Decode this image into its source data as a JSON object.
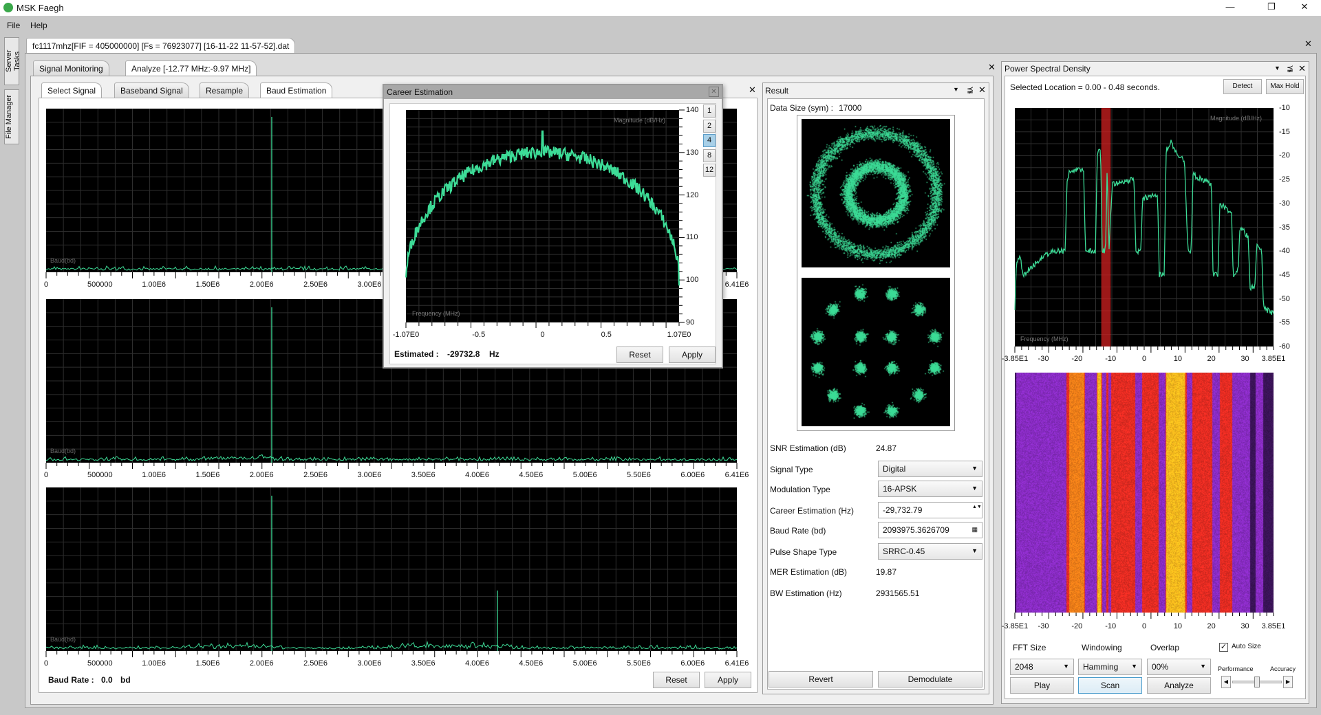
{
  "app": {
    "title": "MSK Faegh",
    "menu": [
      "File",
      "Help"
    ],
    "side_tabs": [
      "Server Tasks",
      "File Manager"
    ]
  },
  "doc_tab": "fc1117mhz[FIF = 405000000] [Fs = 76923077] [16-11-22 11-57-52].dat",
  "analysis_tabs": [
    "Signal Monitoring",
    "Analyze [-12.77 MHz:-9.97 MHz]"
  ],
  "sub_tabs": [
    "Select Signal",
    "Baseband Signal",
    "Resample",
    "Baud Estimation"
  ],
  "baud": {
    "plot_label": "Baud(bd)",
    "x_ticks": [
      "0",
      "500000",
      "1.00E6",
      "1.50E6",
      "2.00E6",
      "2.50E6",
      "3.00E6",
      "3.50E6",
      "4.00E6",
      "4.50E6",
      "5.00E6",
      "5.50E6",
      "6.00E6",
      "6.41E6"
    ],
    "x_tick_values": [
      0,
      500000,
      1000000,
      1500000,
      2000000,
      2500000,
      3000000,
      3500000,
      4000000,
      4500000,
      5000000,
      5500000,
      6000000,
      6410000
    ],
    "xlim": [
      0,
      6410000
    ],
    "peaks": [
      [
        2093975
      ],
      [
        2093975
      ],
      [
        2093975,
        4187950
      ]
    ],
    "baud_rate_label": "Baud Rate :",
    "baud_rate_value": "0.0",
    "baud_rate_unit": "bd",
    "reset": "Reset",
    "apply": "Apply"
  },
  "career": {
    "title": "Career Estimation",
    "ylabel": "Magnitude (dB/Hz)",
    "xlabel": "Frequency (MHz)",
    "x_ticks": [
      "-1.07E0",
      "-0.5",
      "0",
      "0.5",
      "1.07E0"
    ],
    "x_tick_values": [
      -1.07,
      -0.5,
      0,
      0.5,
      1.07
    ],
    "y_ticks": [
      "140",
      "130",
      "120",
      "110",
      "100",
      "90"
    ],
    "y_tick_values": [
      140,
      130,
      120,
      110,
      100,
      90
    ],
    "xlim": [
      -1.07,
      1.07
    ],
    "ylim": [
      90,
      140
    ],
    "power_buttons": [
      "1",
      "2",
      "4",
      "8",
      "12"
    ],
    "power_selected": "4",
    "estimated_label": "Estimated :",
    "estimated_value": "-29732.8",
    "estimated_unit": "Hz",
    "reset": "Reset",
    "apply": "Apply"
  },
  "result": {
    "title": "Result",
    "data_size_label": "Data Size (sym) :",
    "data_size": "17000",
    "rows": [
      {
        "label": "SNR Estimation (dB)",
        "value": "24.87",
        "kind": "text"
      },
      {
        "label": "Signal Type",
        "value": "Digital",
        "kind": "select"
      },
      {
        "label": "Modulation Type",
        "value": "16-APSK",
        "kind": "select"
      },
      {
        "label": "Career Estimation (Hz)",
        "value": "-29,732.79",
        "kind": "spin"
      },
      {
        "label": "Baud Rate (bd)",
        "value": "2093975.3626709",
        "kind": "calc"
      },
      {
        "label": "Pulse Shape Type",
        "value": "SRRC-0.45",
        "kind": "select"
      },
      {
        "label": "MER Estimation (dB)",
        "value": "19.87",
        "kind": "text"
      },
      {
        "label": "BW Estimation (Hz)",
        "value": "2931565.51",
        "kind": "text"
      }
    ],
    "revert": "Revert",
    "demodulate": "Demodulate"
  },
  "psd": {
    "title": "Power Spectral Density",
    "selected_location": "Selected Location = 0.00 - 0.48 seconds.",
    "detect": "Detect",
    "max_hold": "Max Hold",
    "ylabel": "Magnitude (dB/Hz)",
    "xlabel": "Frequency (MHz)",
    "x_ticks": [
      "-3.85E1",
      "-30",
      "-20",
      "-10",
      "0",
      "10",
      "20",
      "30",
      "3.85E1"
    ],
    "x_tick_values": [
      -38.5,
      -30,
      -20,
      -10,
      0,
      10,
      20,
      30,
      38.5
    ],
    "y_ticks": [
      "-10",
      "-15",
      "-20",
      "-25",
      "-30",
      "-35",
      "-40",
      "-45",
      "-50",
      "-55",
      "-60"
    ],
    "y_tick_values": [
      -10,
      -15,
      -20,
      -25,
      -30,
      -35,
      -40,
      -45,
      -50,
      -55,
      -60
    ],
    "xlim": [
      -38.5,
      38.5
    ],
    "ylim": [
      -60,
      -10
    ],
    "selection_mhz": [
      -12.77,
      -9.97
    ],
    "series": [
      [
        -38.5,
        -52
      ],
      [
        -38,
        -42
      ],
      [
        -37,
        -41
      ],
      [
        -36,
        -45
      ],
      [
        -33,
        -43
      ],
      [
        -30,
        -41
      ],
      [
        -27,
        -40
      ],
      [
        -23.5,
        -40
      ],
      [
        -23,
        -25
      ],
      [
        -22,
        -23
      ],
      [
        -18,
        -23
      ],
      [
        -17.5,
        -40
      ],
      [
        -14.5,
        -40
      ],
      [
        -14,
        -20
      ],
      [
        -13,
        -18
      ],
      [
        -12.5,
        -40
      ],
      [
        -11.5,
        -40
      ],
      [
        -11,
        -22
      ],
      [
        -10.5,
        -40
      ],
      [
        -9.5,
        -26
      ],
      [
        -3,
        -25
      ],
      [
        -2.5,
        -40
      ],
      [
        -1,
        -40
      ],
      [
        -0.5,
        -29
      ],
      [
        4,
        -28
      ],
      [
        4.5,
        -45
      ],
      [
        6,
        -45
      ],
      [
        6.5,
        -19
      ],
      [
        8,
        -17
      ],
      [
        10,
        -20
      ],
      [
        12,
        -21
      ],
      [
        13,
        -40
      ],
      [
        14,
        -40
      ],
      [
        14.5,
        -24
      ],
      [
        20,
        -26
      ],
      [
        20.5,
        -45
      ],
      [
        22,
        -45
      ],
      [
        22.5,
        -30
      ],
      [
        26,
        -32
      ],
      [
        26.5,
        -45
      ],
      [
        28,
        -44
      ],
      [
        28.5,
        -35
      ],
      [
        31,
        -37
      ],
      [
        31.5,
        -48
      ],
      [
        33,
        -47
      ],
      [
        33.5,
        -38
      ],
      [
        35,
        -40
      ],
      [
        35.5,
        -52
      ],
      [
        38.5,
        -53
      ]
    ],
    "trace_color": "#3ddc97",
    "selection_color": "#d02020",
    "fft_label": "FFT Size",
    "fft": "2048",
    "window_label": "Windowing",
    "window": "Hamming",
    "overlap_label": "Overlap",
    "overlap": "00%",
    "auto_size": "Auto Size",
    "auto_size_checked": true,
    "performance": "Performance",
    "accuracy": "Accuracy",
    "slider_fraction": 0.5,
    "play": "Play",
    "scan": "Scan",
    "analyze": "Analyze"
  },
  "colors": {
    "trace": "#3ddc97",
    "grid": "#2e2e2e",
    "plot_bg": "#000000"
  }
}
